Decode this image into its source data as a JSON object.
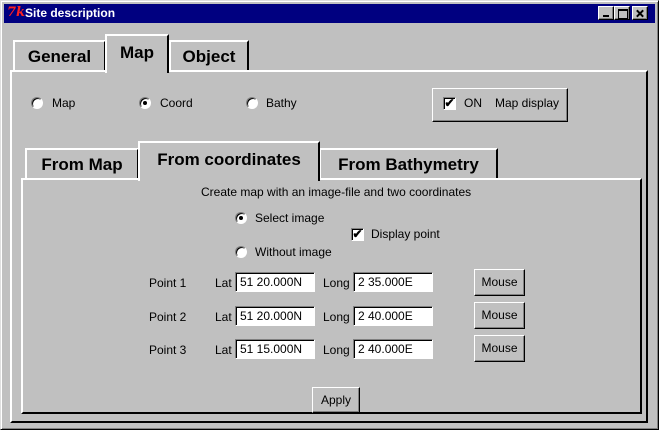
{
  "window": {
    "title": "Site description",
    "icon": "tk-icon",
    "controls": [
      "minimize",
      "maximize",
      "close"
    ]
  },
  "main_tabs": {
    "general": "General",
    "map": "Map",
    "object": "Object",
    "selected": "Map"
  },
  "mode": {
    "map_label": "Map",
    "coord_label": "Coord",
    "bathy_label": "Bathy",
    "selected": "Coord",
    "on_checked": true,
    "on_label": "ON",
    "map_display_label": "Map display"
  },
  "sub_tabs": {
    "from_map": "From Map",
    "from_coordinates": "From coordinates",
    "from_bathymetry": "From Bathymetry",
    "selected": "From coordinates"
  },
  "coordinates": {
    "description": "Create map with an image-file and two coordinates",
    "select_image_label": "Select image",
    "without_image_label": "Without image",
    "image_choice": "Select image",
    "display_point_checked": true,
    "display_point_label": "Display point",
    "lat_label": "Lat",
    "long_label": "Long",
    "mouse_label": "Mouse",
    "points": [
      {
        "label": "Point 1",
        "lat": "51 20.000N",
        "long": "2 35.000E"
      },
      {
        "label": "Point 2",
        "lat": "51 20.000N",
        "long": "2 40.000E"
      },
      {
        "label": "Point 3",
        "lat": "51 15.000N",
        "long": "2 40.000E"
      }
    ],
    "apply_label": "Apply"
  },
  "checkmark": "✔"
}
